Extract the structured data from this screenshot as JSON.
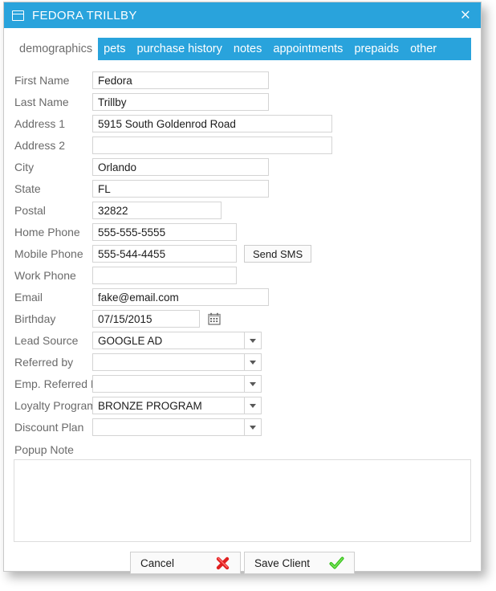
{
  "window": {
    "title": "FEDORA TRILLBY",
    "close_label": "×",
    "accent_color": "#29a3dc"
  },
  "tabs": [
    {
      "label": "demographics",
      "active": true
    },
    {
      "label": "pets",
      "active": false
    },
    {
      "label": "purchase history",
      "active": false
    },
    {
      "label": "notes",
      "active": false
    },
    {
      "label": "appointments",
      "active": false
    },
    {
      "label": "prepaids",
      "active": false
    },
    {
      "label": "other",
      "active": false
    }
  ],
  "form": {
    "first_name": {
      "label": "First Name",
      "value": "Fedora"
    },
    "last_name": {
      "label": "Last Name",
      "value": "Trillby"
    },
    "address1": {
      "label": "Address 1",
      "value": "5915 South Goldenrod Road"
    },
    "address2": {
      "label": "Address 2",
      "value": ""
    },
    "city": {
      "label": "City",
      "value": "Orlando"
    },
    "state": {
      "label": "State",
      "value": "FL"
    },
    "postal": {
      "label": "Postal",
      "value": "32822"
    },
    "home_phone": {
      "label": "Home Phone",
      "value": "555-555-5555"
    },
    "mobile_phone": {
      "label": "Mobile Phone",
      "value": "555-544-4455"
    },
    "work_phone": {
      "label": "Work Phone",
      "value": ""
    },
    "email": {
      "label": "Email",
      "value": "fake@email.com"
    },
    "birthday": {
      "label": "Birthday",
      "value": "07/15/2015"
    },
    "lead_source": {
      "label": "Lead Source",
      "value": "GOOGLE AD"
    },
    "referred_by": {
      "label": "Referred by",
      "value": ""
    },
    "emp_referred_by": {
      "label": "Emp. Referred By",
      "value": ""
    },
    "loyalty_program": {
      "label": "Loyalty Program",
      "value": "BRONZE PROGRAM"
    },
    "discount_plan": {
      "label": "Discount Plan",
      "value": ""
    },
    "popup_note": {
      "label": "Popup Note",
      "value": ""
    },
    "send_sms_label": "Send SMS"
  },
  "buttons": {
    "cancel": "Cancel",
    "save": "Save Client"
  },
  "colors": {
    "cancel_icon": "#e02020",
    "save_icon": "#35c21a"
  }
}
